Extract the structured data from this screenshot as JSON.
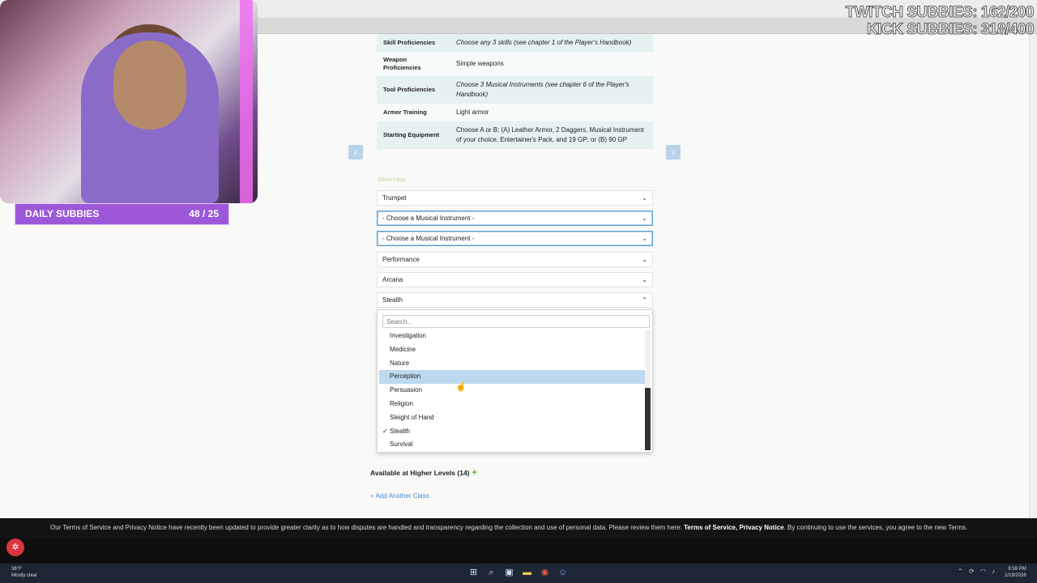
{
  "proficiency_table": [
    {
      "key": "Skill Proficiencies",
      "value": "Choose any 3 skills (see chapter 1 of the Player's Handbook)"
    },
    {
      "key": "Weapon Proficiencies",
      "value": "Simple weapons"
    },
    {
      "key": "Tool Proficiencies",
      "value": "Choose 3 Musical Instruments (see chapter 6 of the Player's Handbook)"
    },
    {
      "key": "Armor Training",
      "value": "Light armor"
    },
    {
      "key": "Starting Equipment",
      "value": "Choose A or B: (A) Leather Armor, 2 Daggers, Musical Instrument of your choice, Entertainer's Pack, and 19 GP; or (B) 90 GP"
    }
  ],
  "show_less": "Show Less",
  "selects": {
    "instrument_1": "Trumpet",
    "instrument_2": "- Choose a Musical Instrument -",
    "instrument_3": "- Choose a Musical Instrument -",
    "skill_1": "Performance",
    "skill_2": "Arcana",
    "skill_3": "Stealth"
  },
  "dropdown": {
    "search_placeholder": "Search...",
    "options": [
      "Investigation",
      "Medicine",
      "Nature",
      "Perception",
      "Persuasion",
      "Religion",
      "Sleight of Hand",
      "Stealth",
      "Survival"
    ],
    "highlighted": "Perception",
    "selected": "Stealth"
  },
  "higher_levels": "Available at Higher Levels (14)",
  "add_class": "+ Add Another Class",
  "terms": {
    "text": "Our Terms of Service and Privacy Notice have recently been updated to provide greater clarity as to how disputes are handled and transparency regarding the collection and use of personal data. Please review them here:",
    "tos_link": "Terms of Service,",
    "privacy_link": "Privacy Notice",
    "suffix": ". By continuing to use the services, you agree to the new Terms."
  },
  "overlay": {
    "daily_subbies_label": "DAILY SUBBIES",
    "daily_subbies_count": "48 / 25",
    "twitch_subbies": "TWITCH SUBBIES: 162/200",
    "kick_subbies": "KICK SUBBIES: 318/400"
  },
  "taskbar": {
    "weather_temp": "36°F",
    "weather_desc": "Mostly clear",
    "time": "9:59 PM",
    "date": "1/19/2026"
  },
  "icons": {
    "windows": "windows-start-icon",
    "search": "search-icon",
    "taskview": "task-view-icon",
    "explorer": "file-explorer-icon",
    "chrome": "chrome-icon",
    "discord": "discord-icon"
  }
}
